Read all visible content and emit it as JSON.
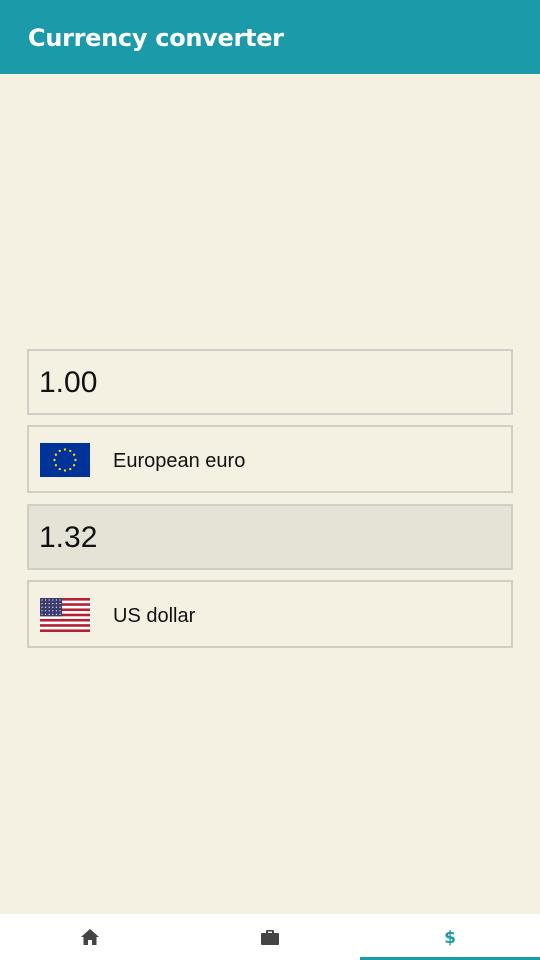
{
  "appbar": {
    "title": "Currency converter"
  },
  "converter": {
    "from_amount": "1.00",
    "from_currency": {
      "name": "European euro",
      "flag": "eu-flag-icon"
    },
    "to_amount": "1.32",
    "to_currency": {
      "name": "US dollar",
      "flag": "us-flag-icon"
    }
  },
  "bottom_nav": {
    "tabs": [
      {
        "icon": "home-icon",
        "active": false
      },
      {
        "icon": "briefcase-icon",
        "active": false
      },
      {
        "icon": "dollar-icon",
        "active": true
      }
    ]
  },
  "colors": {
    "primary": "#1b9aaa",
    "background": "#f4f0e2",
    "output_background": "#e5e2d6",
    "border": "#cfcdc5",
    "nav_icon": "#444444"
  }
}
